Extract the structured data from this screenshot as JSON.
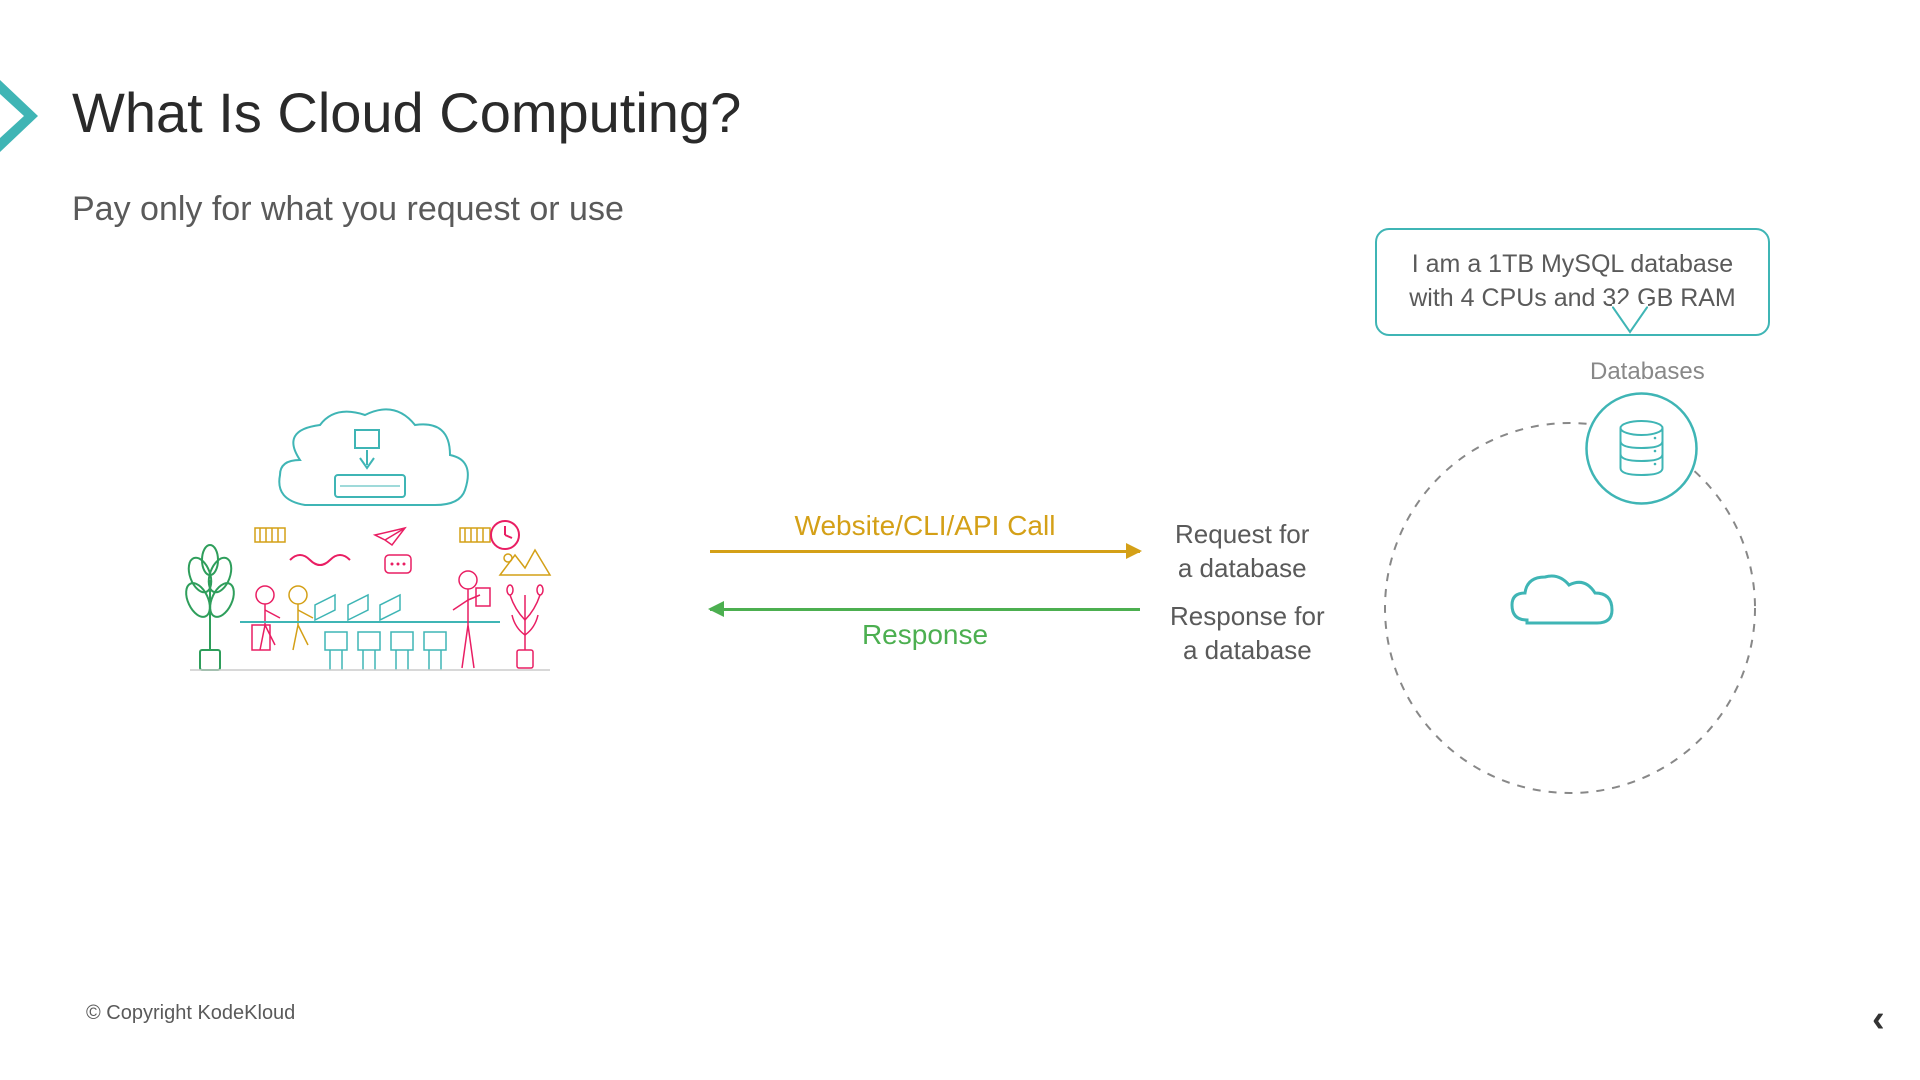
{
  "title": "What Is Cloud Computing?",
  "subtitle": "Pay only for what you request or use",
  "arrows": {
    "request_label": "Website/CLI/API Call",
    "response_label": "Response"
  },
  "labels": {
    "request_for": "Request for\na database",
    "response_for": "Response for\na database",
    "databases": "Databases"
  },
  "speech_bubble": "I am a 1TB MySQL database with 4 CPUs and 32 GB RAM",
  "copyright": "© Copyright KodeKloud",
  "colors": {
    "teal": "#3fb5b5",
    "gold": "#d4a017",
    "green": "#4caf50",
    "pink": "#e91e63"
  }
}
